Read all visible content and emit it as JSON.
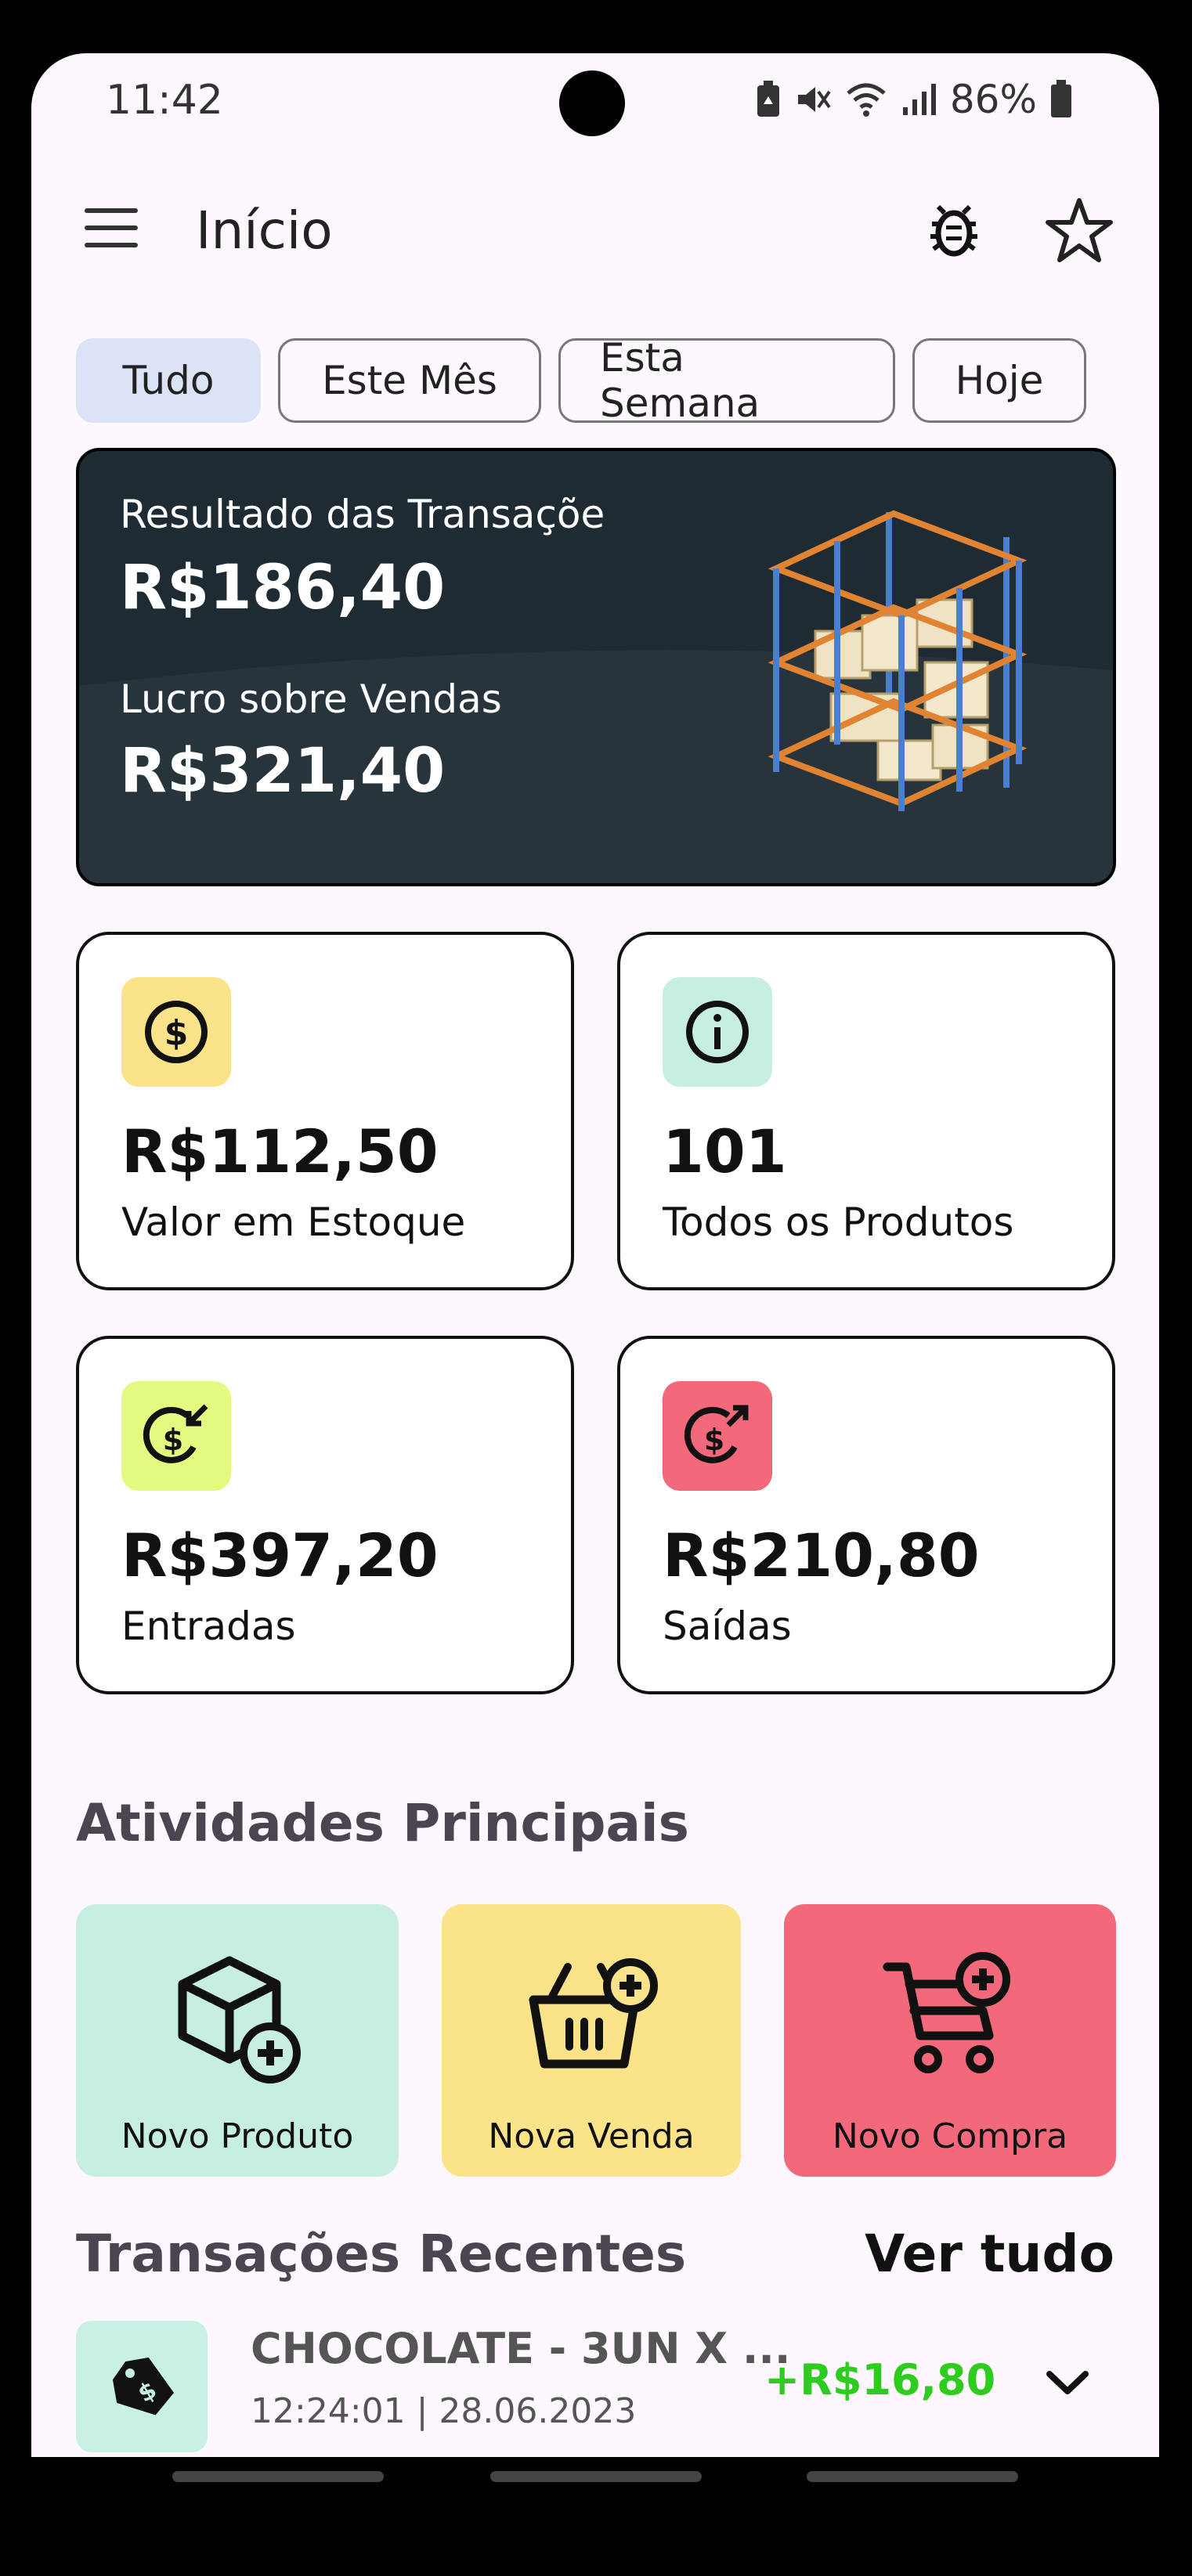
{
  "status_bar": {
    "time": "11:42",
    "battery": "86%"
  },
  "header": {
    "title": "Início",
    "menu_icon": "menu-icon",
    "bug_icon": "bug-icon",
    "star_icon": "star-icon"
  },
  "filters": [
    "Tudo",
    "Este Mês",
    "Esta Semana",
    "Hoje"
  ],
  "summary": {
    "result_label": "Resultado das Transaçõe",
    "result_value": "R$186,40",
    "profit_label": "Lucro sobre Vendas",
    "profit_value": "R$321,40"
  },
  "stats": [
    {
      "value": "R$112,50",
      "label": "Valor em Estoque",
      "icon": "dollar-icon",
      "color": "#fbe38a"
    },
    {
      "value": "101",
      "label": "Todos os Produtos",
      "icon": "info-icon",
      "color": "#c6efe2"
    },
    {
      "value": "R$397,20",
      "label": "Entradas",
      "icon": "money-in-icon",
      "color": "#e2fb7e"
    },
    {
      "value": "R$210,80",
      "label": "Saídas",
      "icon": "money-out-icon",
      "color": "#f2697b"
    }
  ],
  "activities": {
    "title": "Atividades Principais",
    "items": [
      {
        "label": "Novo Produto",
        "icon": "box-plus-icon",
        "color": "#c6efe2"
      },
      {
        "label": "Nova Venda",
        "icon": "basket-plus-icon",
        "color": "#fbe38a"
      },
      {
        "label": "Novo Compra",
        "icon": "cart-plus-icon",
        "color": "#f2697b"
      }
    ]
  },
  "recent": {
    "title": "Transações Recentes",
    "see_all": "Ver tudo",
    "items": [
      {
        "title": "CHOCOLATE - 3UN X ...",
        "date": "12:24:01 | 28.06.2023",
        "amount": "+R$16,80",
        "icon": "price-tag-icon"
      }
    ]
  }
}
